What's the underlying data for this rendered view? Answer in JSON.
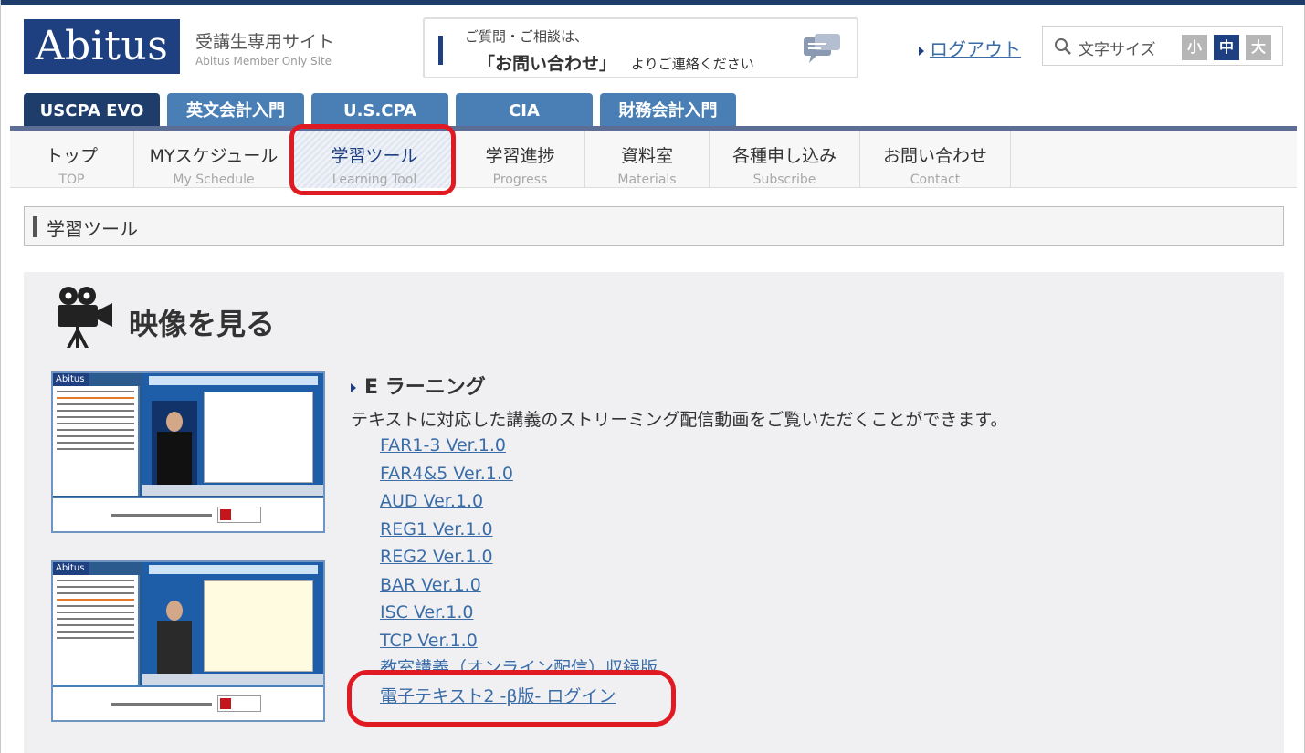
{
  "header": {
    "logo_text": "Abitus",
    "site_title": "受講生専用サイト",
    "site_subtitle": "Abitus Member Only Site",
    "inquiry_line1": "ご質問・ご相談は、",
    "inquiry_line2": "「お問い合わせ」",
    "inquiry_line2_tail": "よりご連絡ください",
    "logout_label": "ログアウト",
    "fontsize_label": "文字サイズ",
    "fontsize_small": "小",
    "fontsize_medium": "中",
    "fontsize_large": "大",
    "fontsize_selected": "中"
  },
  "course_tabs": [
    {
      "label": "USCPA EVO",
      "active": true
    },
    {
      "label": "英文会計入門",
      "active": false
    },
    {
      "label": "U.S.CPA",
      "active": false
    },
    {
      "label": "CIA",
      "active": false
    },
    {
      "label": "財務会計入門",
      "active": false
    }
  ],
  "main_nav": [
    {
      "jp": "トップ",
      "en": "TOP"
    },
    {
      "jp": "MYスケジュール",
      "en": "My Schedule"
    },
    {
      "jp": "学習ツール",
      "en": "Learning Tool",
      "active": true
    },
    {
      "jp": "学習進捗",
      "en": "Progress"
    },
    {
      "jp": "資料室",
      "en": "Materials"
    },
    {
      "jp": "各種申し込み",
      "en": "Subscribe"
    },
    {
      "jp": "お問い合わせ",
      "en": "Contact"
    }
  ],
  "section_title": "学習ツール",
  "video_section": {
    "heading": "映像を見る",
    "thumb_logo": "Abitus",
    "elearning_heading": "E ラーニング",
    "elearning_description": "テキストに対応した講義のストリーミング配信動画をご覧いただくことができます。",
    "links": [
      "FAR1-3 Ver.1.0",
      "FAR4&5 Ver.1.0",
      "AUD Ver.1.0",
      "REG1 Ver.1.0",
      "REG2 Ver.1.0",
      "BAR Ver.1.0",
      "ISC Ver.1.0",
      "TCP Ver.1.0",
      "教室講義（オンライン配信）収録版",
      "電子テキスト2 -β版- ログイン"
    ]
  },
  "colors": {
    "brand_navy": "#1e3f80",
    "tab_blue": "#4a7fb5",
    "link_blue": "#3a6da8",
    "highlight_red": "#e01a22"
  },
  "icons": [
    "chat-bubble-icon",
    "magnifier-icon",
    "movie-camera-icon",
    "triangle-bullet-icon"
  ]
}
